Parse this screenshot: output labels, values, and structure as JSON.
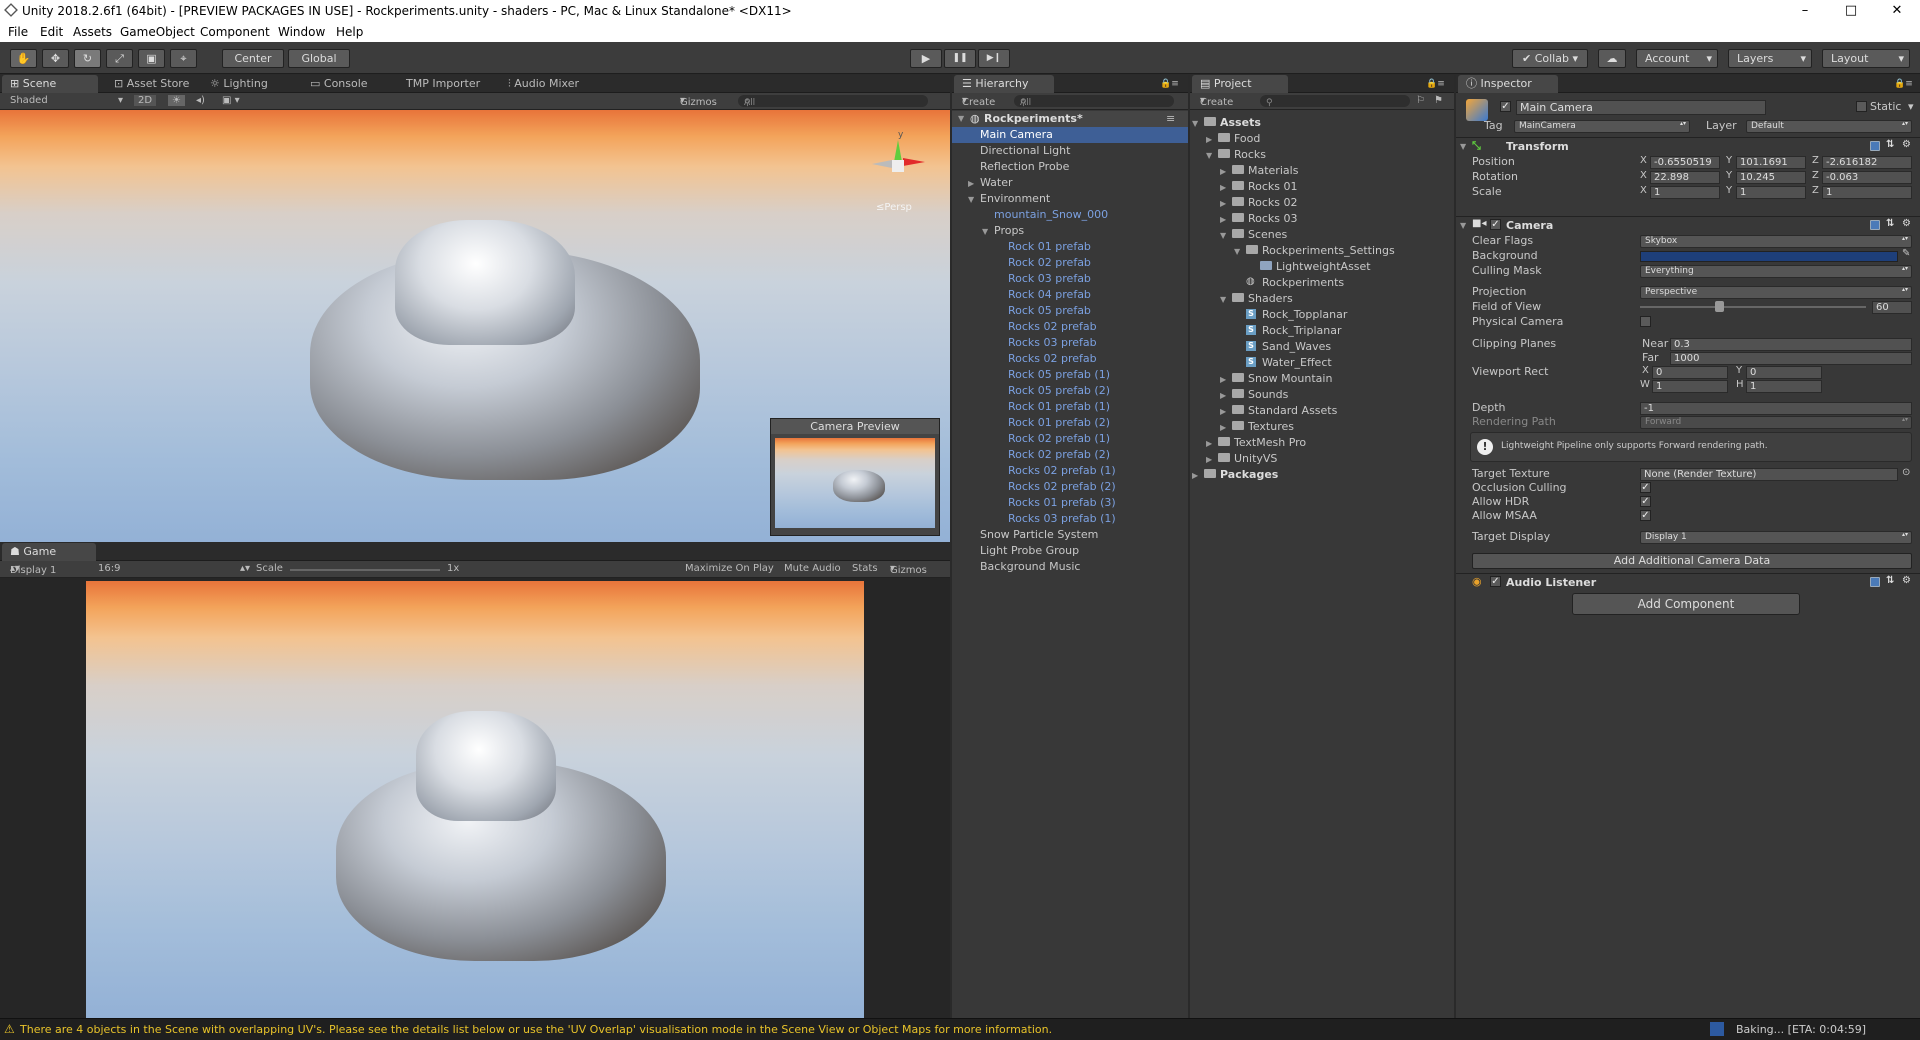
{
  "window": {
    "title": "Unity 2018.2.6f1 (64bit) - [PREVIEW PACKAGES IN USE] - Rockperiments.unity - shaders - PC, Mac & Linux Standalone* <DX11>",
    "minimize": "–",
    "maximize": "□",
    "close": "✕"
  },
  "menu": [
    "File",
    "Edit",
    "Assets",
    "GameObject",
    "Component",
    "Window",
    "Help"
  ],
  "toolbar": {
    "tools": [
      "✋",
      "✥",
      "↻",
      "⤢",
      "▣",
      "⌖"
    ],
    "center": "Center",
    "global": "Global",
    "play": "▶",
    "pause": "❚❚",
    "step": "▶❙",
    "collab": "✔ Collab ▾",
    "cloud": "☁",
    "account": "Account",
    "layers": "Layers",
    "layout": "Layout"
  },
  "scene": {
    "tabs": [
      "Scene",
      "Asset Store",
      "Lighting",
      "Console",
      "TMP Importer",
      "Audio Mixer"
    ],
    "shaded": "Shaded",
    "mode2d": "2D",
    "gizmos": "Gizmos",
    "search_placeholder": "All",
    "persp": "Persp",
    "axis_y": "y",
    "camera_preview": "Camera Preview"
  },
  "game": {
    "tab": "Game",
    "display": "Display 1",
    "aspect": "16:9",
    "scale_label": "Scale",
    "scale_value": "1x",
    "maximize": "Maximize On Play",
    "mute": "Mute Audio",
    "stats": "Stats",
    "gizmos": "Gizmos"
  },
  "hierarchy": {
    "tab": "Hierarchy",
    "create": "Create",
    "search_placeholder": "All",
    "scene_name": "Rockperiments*",
    "items": [
      {
        "label": "Main Camera",
        "depth": 1,
        "sel": true
      },
      {
        "label": "Directional Light",
        "depth": 1
      },
      {
        "label": "Reflection Probe",
        "depth": 1
      },
      {
        "label": "Water",
        "depth": 1,
        "arrow": "▶"
      },
      {
        "label": "Environment",
        "depth": 1,
        "arrow": "▼"
      },
      {
        "label": "mountain_Snow_000",
        "depth": 2,
        "prefab": true
      },
      {
        "label": "Props",
        "depth": 2,
        "arrow": "▼"
      },
      {
        "label": "Rock 01 prefab",
        "depth": 3,
        "prefab": true
      },
      {
        "label": "Rock 02 prefab",
        "depth": 3,
        "prefab": true
      },
      {
        "label": "Rock 03 prefab",
        "depth": 3,
        "prefab": true
      },
      {
        "label": "Rock 04 prefab",
        "depth": 3,
        "prefab": true
      },
      {
        "label": "Rock 05 prefab",
        "depth": 3,
        "prefab": true
      },
      {
        "label": "Rocks 02 prefab",
        "depth": 3,
        "prefab": true
      },
      {
        "label": "Rocks 03 prefab",
        "depth": 3,
        "prefab": true
      },
      {
        "label": "Rocks 02 prefab",
        "depth": 3,
        "prefab": true
      },
      {
        "label": "Rock 05 prefab (1)",
        "depth": 3,
        "prefab": true
      },
      {
        "label": "Rock 05 prefab (2)",
        "depth": 3,
        "prefab": true
      },
      {
        "label": "Rock 01 prefab (1)",
        "depth": 3,
        "prefab": true
      },
      {
        "label": "Rock 01 prefab (2)",
        "depth": 3,
        "prefab": true
      },
      {
        "label": "Rock 02 prefab (1)",
        "depth": 3,
        "prefab": true
      },
      {
        "label": "Rock 02 prefab (2)",
        "depth": 3,
        "prefab": true
      },
      {
        "label": "Rocks 02 prefab (1)",
        "depth": 3,
        "prefab": true
      },
      {
        "label": "Rocks 02 prefab (2)",
        "depth": 3,
        "prefab": true
      },
      {
        "label": "Rocks 01 prefab (3)",
        "depth": 3,
        "prefab": true
      },
      {
        "label": "Rocks 03 prefab (1)",
        "depth": 3,
        "prefab": true
      },
      {
        "label": "Snow Particle System",
        "depth": 1
      },
      {
        "label": "Light Probe Group",
        "depth": 1
      },
      {
        "label": "Background Music",
        "depth": 1
      }
    ]
  },
  "project": {
    "tab": "Project",
    "create": "Create",
    "items": [
      {
        "label": "Assets",
        "depth": 0,
        "arrow": "▼",
        "icon": "folder",
        "bold": true
      },
      {
        "label": "Food",
        "depth": 1,
        "arrow": "▶",
        "icon": "folder"
      },
      {
        "label": "Rocks",
        "depth": 1,
        "arrow": "▼",
        "icon": "folder"
      },
      {
        "label": "Materials",
        "depth": 2,
        "arrow": "▶",
        "icon": "folder"
      },
      {
        "label": "Rocks 01",
        "depth": 2,
        "arrow": "▶",
        "icon": "folder"
      },
      {
        "label": "Rocks 02",
        "depth": 2,
        "arrow": "▶",
        "icon": "folder"
      },
      {
        "label": "Rocks 03",
        "depth": 2,
        "arrow": "▶",
        "icon": "folder"
      },
      {
        "label": "Scenes",
        "depth": 2,
        "arrow": "▼",
        "icon": "folder"
      },
      {
        "label": "Rockperiments_Settings",
        "depth": 3,
        "arrow": "▼",
        "icon": "folder"
      },
      {
        "label": "LightweightAsset",
        "depth": 4,
        "icon": "asset"
      },
      {
        "label": "Rockperiments",
        "depth": 3,
        "icon": "unity"
      },
      {
        "label": "Shaders",
        "depth": 2,
        "arrow": "▼",
        "icon": "folder"
      },
      {
        "label": "Rock_Topplanar",
        "depth": 3,
        "icon": "shader"
      },
      {
        "label": "Rock_Triplanar",
        "depth": 3,
        "icon": "shader"
      },
      {
        "label": "Sand_Waves",
        "depth": 3,
        "icon": "shader"
      },
      {
        "label": "Water_Effect",
        "depth": 3,
        "icon": "shader"
      },
      {
        "label": "Snow Mountain",
        "depth": 2,
        "arrow": "▶",
        "icon": "folder"
      },
      {
        "label": "Sounds",
        "depth": 2,
        "arrow": "▶",
        "icon": "folder"
      },
      {
        "label": "Standard Assets",
        "depth": 2,
        "arrow": "▶",
        "icon": "folder"
      },
      {
        "label": "Textures",
        "depth": 2,
        "arrow": "▶",
        "icon": "folder"
      },
      {
        "label": "TextMesh Pro",
        "depth": 1,
        "arrow": "▶",
        "icon": "folder"
      },
      {
        "label": "UnityVS",
        "depth": 1,
        "arrow": "▶",
        "icon": "folder"
      },
      {
        "label": "Packages",
        "depth": 0,
        "arrow": "▶",
        "icon": "folder",
        "bold": true
      }
    ]
  },
  "inspector": {
    "tab": "Inspector",
    "name": "Main Camera",
    "static": "Static",
    "tag_label": "Tag",
    "tag_value": "MainCamera",
    "layer_label": "Layer",
    "layer_value": "Default",
    "transform": {
      "title": "Transform",
      "rows": [
        {
          "label": "Position",
          "x": "-0.6550519",
          "y": "101.1691",
          "z": "-2.616182"
        },
        {
          "label": "Rotation",
          "x": "22.898",
          "y": "10.245",
          "z": "-0.063"
        },
        {
          "label": "Scale",
          "x": "1",
          "y": "1",
          "z": "1"
        }
      ]
    },
    "camera": {
      "title": "Camera",
      "clear_flags": {
        "label": "Clear Flags",
        "value": "Skybox"
      },
      "background": {
        "label": "Background",
        "color": "#1e3f7a"
      },
      "culling_mask": {
        "label": "Culling Mask",
        "value": "Everything"
      },
      "projection": {
        "label": "Projection",
        "value": "Perspective"
      },
      "fov": {
        "label": "Field of View",
        "value": "60",
        "fraction": 0.33
      },
      "physical": {
        "label": "Physical Camera"
      },
      "clipping": {
        "label": "Clipping Planes",
        "near_label": "Near",
        "near": "0.3",
        "far_label": "Far",
        "far": "1000"
      },
      "viewport": {
        "label": "Viewport Rect",
        "x": "0",
        "y": "0",
        "w": "1",
        "h": "1",
        "x_label": "X",
        "y_label": "Y",
        "w_label": "W",
        "h_label": "H"
      },
      "depth": {
        "label": "Depth",
        "value": "-1"
      },
      "rendering_path": {
        "label": "Rendering Path",
        "value": "Forward"
      },
      "warning": "Lightweight Pipeline only supports Forward rendering path.",
      "target_texture": {
        "label": "Target Texture",
        "value": "None (Render Texture)"
      },
      "occlusion": {
        "label": "Occlusion Culling"
      },
      "hdr": {
        "label": "Allow HDR"
      },
      "msaa": {
        "label": "Allow MSAA"
      },
      "target_display": {
        "label": "Target Display",
        "value": "Display 1"
      },
      "add_data": "Add Additional Camera Data"
    },
    "audio_listener": "Audio Listener",
    "add_component": "Add Component"
  },
  "status": {
    "warning": "There are 4 objects in the Scene with overlapping UV's. Please see the details list below or use the 'UV Overlap' visualisation mode in the Scene View or Object Maps for more information.",
    "baking": "Baking... [ETA: 0:04:59]"
  },
  "colors": {
    "accent": "#3e5f96",
    "prefab": "#7ba0e0",
    "warning": "#e8c32a"
  }
}
